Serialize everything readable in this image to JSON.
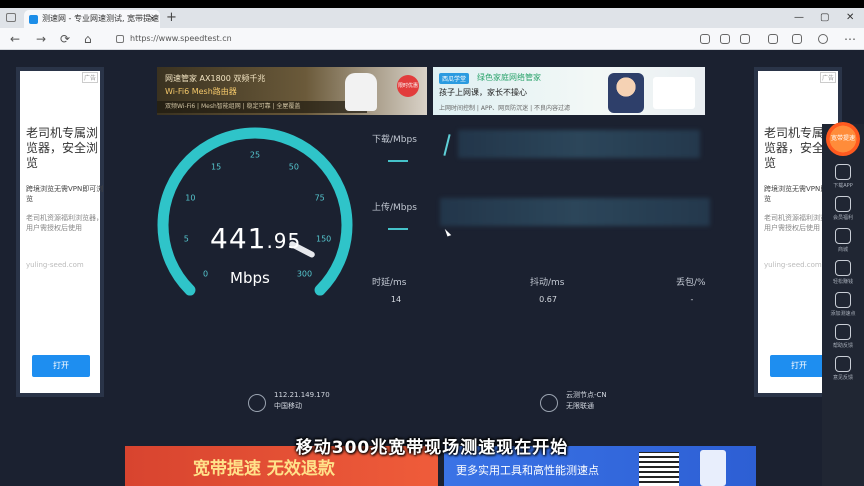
{
  "browser": {
    "tab_title": "测速网 - 专业网速测试, 宽带提速",
    "tab_close": "×",
    "new_tab": "+",
    "url": "https://www.speedtest.cn",
    "window_controls": [
      "—",
      "▢",
      "✕"
    ]
  },
  "side_ads": {
    "tag": "广告",
    "title": "老司机专属浏览器，安全浏览",
    "subtitle": "跨境浏览无需VPN即可浏览",
    "desc": "老司机资源福利浏览器，用户需授权后使用",
    "url": "yuling-seed.com",
    "button": "打开"
  },
  "banner_left": {
    "title": "网速管家 AX1800 双频千兆",
    "subtitle": "Wi-Fi6 Mesh路由器",
    "strip": "双频Wi-Fi6 | Mesh智能组网 | 稳定可靠 | 全屋覆盖",
    "badge": "限时优惠"
  },
  "banner_right": {
    "tag": "西瓜学堂",
    "title": "绿色家庭网络管家",
    "subtitle": "孩子上网课，家长不操心",
    "strip": "上网时间控制 | APP、网页防沉迷 | 不良内容过滤"
  },
  "gauge": {
    "ticks": [
      "0",
      "5",
      "10",
      "15",
      "25",
      "50",
      "75",
      "150",
      "300"
    ],
    "speed_int": "441",
    "speed_dec": ".95",
    "unit": "Mbps"
  },
  "results": {
    "download_label": "下载/Mbps",
    "upload_label": "上传/Mbps",
    "latency_label": "时延/ms",
    "latency_value": "14",
    "jitter_label": "抖动/ms",
    "jitter_value": "0.67",
    "loss_label": "丢包/%",
    "loss_value": "-"
  },
  "info": {
    "ip": "112.21.149.170",
    "isp": "中国移动",
    "node": "云测节点-CN",
    "node_isp": "无限联通"
  },
  "rail": {
    "badge": "宽带提速",
    "items": [
      "下载APP",
      "会员福利",
      "商城",
      "轻松赚钱",
      "添加测速点",
      "帮助反馈",
      "意见反馈"
    ]
  },
  "bottom": {
    "left": "宽带提速 无效退款",
    "right": "更多实用工具和高性能测速点"
  },
  "subtitle": "移动300兆宽带现场测速现在开始"
}
